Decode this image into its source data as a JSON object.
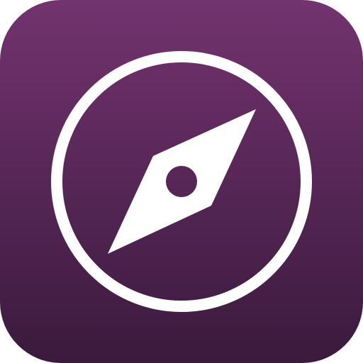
{
  "icon": {
    "name": "compass-icon",
    "colors": {
      "gradient_top": "#73336F",
      "gradient_bottom": "#3A1A3D",
      "glyph": "#FFFFFF"
    }
  }
}
